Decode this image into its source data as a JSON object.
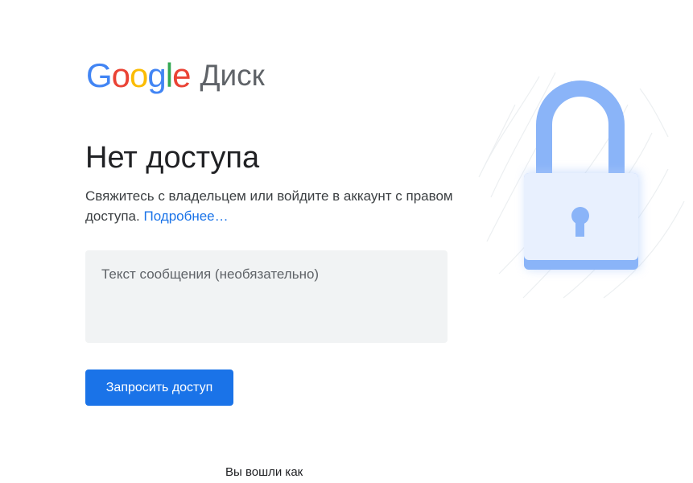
{
  "logo": {
    "google_letters": [
      "G",
      "o",
      "o",
      "g",
      "l",
      "e"
    ],
    "product_name": "Диск"
  },
  "main": {
    "title": "Нет доступа",
    "description": "Свяжитесь с владельцем или войдите в аккаунт с правом доступа.",
    "learn_more_link": "Подробнее…",
    "message_placeholder": "Текст сообщения (необязательно)",
    "message_value": "",
    "request_button_label": "Запросить доступ"
  },
  "footer": {
    "signed_in_as": "Вы вошли как"
  },
  "illustration": {
    "icon": "lock-icon"
  },
  "colors": {
    "google_blue": "#4285f4",
    "google_red": "#ea4335",
    "google_yellow": "#fbbc05",
    "google_green": "#34a853",
    "button_blue": "#1a73e8",
    "link_blue": "#1a73e8",
    "lock_shackle": "#8ab4f8",
    "lock_body": "#e8f0fe",
    "lock_keyhole": "#8ab4f8"
  }
}
